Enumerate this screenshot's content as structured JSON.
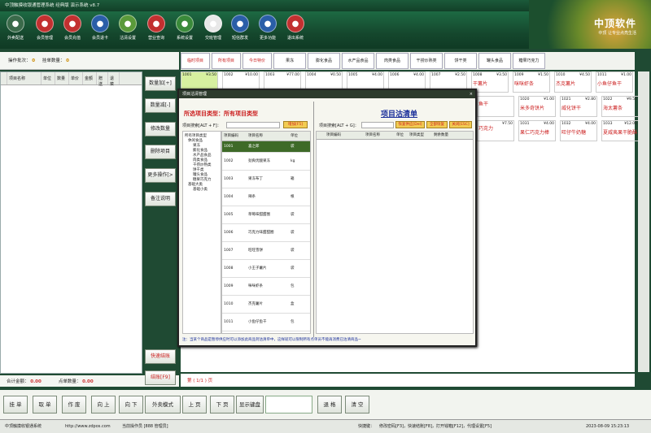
{
  "window": {
    "title": "中顶触摸收银通管理系统 经典版 演示系统 v8.7",
    "controls": [
      "_",
      "□",
      "×"
    ]
  },
  "toolbar": [
    {
      "label": "外卖配送",
      "icon": "scooter-icon",
      "color": "#3a6a4a"
    },
    {
      "label": "会员管理",
      "icon": "member-icon",
      "color": "#c23030"
    },
    {
      "label": "会员充值",
      "icon": "recharge-icon",
      "color": "#c23030"
    },
    {
      "label": "会员退卡",
      "icon": "card-icon",
      "color": "#2a5ea8"
    },
    {
      "label": "沽清设置",
      "icon": "cup-icon",
      "color": "#5a9a3a"
    },
    {
      "label": "营业查询",
      "icon": "search-icon",
      "color": "#c23030"
    },
    {
      "label": "系统设置",
      "icon": "gear-icon",
      "color": "#3a8a3a"
    },
    {
      "label": "交班管理",
      "icon": "exchange-icon",
      "color": "#e8e8e8"
    },
    {
      "label": "短信群发",
      "icon": "sms-icon",
      "color": "#2a5ea8"
    },
    {
      "label": "更多功能",
      "icon": "more-icon",
      "color": "#2a5ea8"
    },
    {
      "label": "退出系统",
      "icon": "exit-icon",
      "color": "#c23030"
    }
  ],
  "brand": {
    "name": "中顶软件",
    "slogan": "中顶 让专业点亮生活"
  },
  "order": {
    "batch_label": "操作批次：",
    "batch_value": "0",
    "count_label": "挂单数量：",
    "count_value": "0",
    "columns": [
      "",
      "项目名称",
      "单位",
      "数量",
      "单价",
      "金额",
      "赠送",
      "退菜"
    ],
    "total_label": "合计金额：",
    "total_value": "0.00",
    "qty_label": "点单数量：",
    "qty_value": "0.00"
  },
  "side_buttons": [
    {
      "label": "数量加[+]",
      "red": false
    },
    {
      "label": "数量减[-]",
      "red": false
    },
    {
      "label": "修改数量",
      "red": false
    },
    {
      "label": "删除项目",
      "red": false
    },
    {
      "label": "更多操作[>",
      "red": false
    },
    {
      "label": "备注说明",
      "red": false
    },
    {
      "label": "快速结账",
      "red": true
    },
    {
      "label": "结账[F9]",
      "red": true
    }
  ],
  "categories": [
    {
      "label": "临时项目",
      "red": true
    },
    {
      "label": "所有项目",
      "red": true
    },
    {
      "label": "今日特价",
      "red": true
    },
    {
      "label": "果冻",
      "red": false
    },
    {
      "label": "膨化食品",
      "red": false
    },
    {
      "label": "水产品食品",
      "red": false
    },
    {
      "label": "肉类食品",
      "red": false
    },
    {
      "label": "干捞炒熟类",
      "red": false
    },
    {
      "label": "饼干类",
      "red": false
    },
    {
      "label": "罐头食品",
      "red": false
    },
    {
      "label": "糖果巧克力",
      "red": false
    }
  ],
  "products_row1": [
    {
      "code": "1001",
      "price": "¥3.50",
      "name": "",
      "selected": true
    },
    {
      "code": "1002",
      "price": "¥10.00",
      "name": ""
    },
    {
      "code": "1003",
      "price": "¥77.00",
      "name": ""
    },
    {
      "code": "1004",
      "price": "¥0.50",
      "name": ""
    },
    {
      "code": "1005",
      "price": "¥4.00",
      "name": ""
    },
    {
      "code": "1006",
      "price": "¥4.00",
      "name": ""
    },
    {
      "code": "1007",
      "price": "¥2.50",
      "name": ""
    },
    {
      "code": "1008",
      "price": "¥3.50",
      "name": "干薯片"
    },
    {
      "code": "1009",
      "price": "¥1.50",
      "name": "咪咪虾条"
    },
    {
      "code": "1010",
      "price": "¥4.50",
      "name": "杰克薯片"
    },
    {
      "code": "1011",
      "price": "¥1.00",
      "name": "小鱼仔鱼干"
    }
  ],
  "products_row2": [
    {
      "code": "",
      "price": "",
      "name": "鱼干"
    },
    {
      "code": "1020",
      "price": "¥1.00",
      "name": "米多奇饼片"
    },
    {
      "code": "1021",
      "price": "¥2.80",
      "name": "威化饼干"
    },
    {
      "code": "1022",
      "price": "¥9.50",
      "name": "海太薯条"
    }
  ],
  "products_row3": [
    {
      "code": "",
      "price": "¥7.50",
      "name": "巧克力"
    },
    {
      "code": "1031",
      "price": "¥4.00",
      "name": "果仁巧克力棒"
    },
    {
      "code": "1032",
      "price": "¥4.00",
      "name": "旺仔牛奶糖"
    },
    {
      "code": "1033",
      "price": "¥12.00",
      "name": "夏威夷果干脆酥"
    }
  ],
  "page_line": "第 ( 1/1 ) 页",
  "bottom_buttons": [
    "挂 单",
    "取 单",
    "作 废",
    "向 上",
    "向 下",
    "外卖模式",
    "上 页",
    "下 页",
    "显示键盘",
    "退 格",
    "清 空"
  ],
  "status": {
    "company": "中顶触摸收银通系统",
    "url": "http://www.zdpos.com",
    "operator": "当前操作员 [888 管理员]",
    "hotkeys_label": "快捷键：",
    "hotkeys": "修改密码[F3]，快速结账[F8]，打开钱箱[F12]，代理设置[F5]",
    "datetime": "2023-08-09 15:23:13"
  },
  "dialog": {
    "title": "项目沽清管理",
    "close": "×",
    "left_header": "所选项目类型：所有项目类型",
    "right_header": "项目沽清单",
    "search_label": "项目搜索[ALT + F]：",
    "add_button": "增加[F5]",
    "search_label2": "项目搜索[ALT + G]：",
    "btn_restore": "恢复供应[Del]",
    "btn_restore_all": "全部恢复",
    "btn_close": "关闭[ESC]",
    "tree": [
      "所有项目类型",
      "休闲食品",
      "果冻",
      "膨化食品",
      "水产品食品",
      "肉类食品",
      "干捞炒熟类",
      "饼干类",
      "罐头食品",
      "糖果巧克力",
      "基础大类",
      "基础小类"
    ],
    "item_columns": [
      "项目编码",
      "项目名称",
      "单位"
    ],
    "items": [
      {
        "code": "1001",
        "name": "喜之郎",
        "unit": "袋",
        "sel": true
      },
      {
        "code": "1002",
        "name": "劲爽优酸果冻",
        "unit": "kg"
      },
      {
        "code": "1003",
        "name": "果冻布丁",
        "unit": "箱"
      },
      {
        "code": "1004",
        "name": "辣条",
        "unit": "根"
      },
      {
        "code": "1005",
        "name": "草莓味甜甜圈",
        "unit": "袋"
      },
      {
        "code": "1006",
        "name": "巧克力味甜甜圈",
        "unit": "袋"
      },
      {
        "code": "1007",
        "name": "旺旺雪饼",
        "unit": "袋"
      },
      {
        "code": "1008",
        "name": "小王子薯片",
        "unit": "袋"
      },
      {
        "code": "1009",
        "name": "咪咪虾条",
        "unit": "包"
      },
      {
        "code": "1010",
        "name": "杰克薯片",
        "unit": "盒"
      },
      {
        "code": "1011",
        "name": "小鱼仔鱼干",
        "unit": "包"
      }
    ],
    "right_columns": [
      "项目编码",
      "项目名称",
      "单位",
      "项目类型",
      "剩余数量"
    ],
    "tip": "注：当某个商品是暂停供应时可以添加此商品到沽清单中，这样就可以限制所有点单员不能再消费已沽清商品~"
  }
}
